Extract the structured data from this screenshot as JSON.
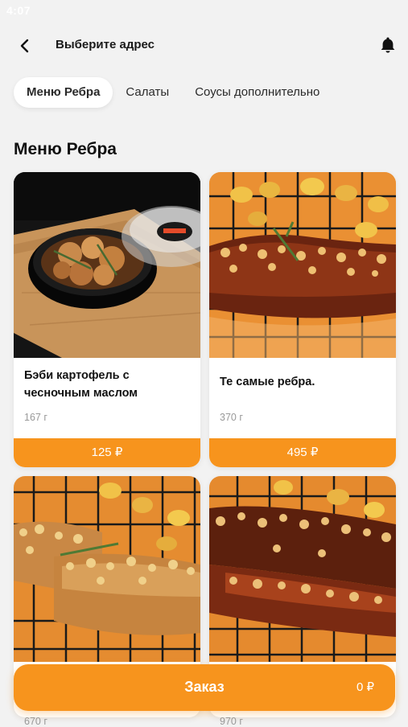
{
  "status": {
    "time": "4:07"
  },
  "header": {
    "title": "Выберите адрес",
    "back_icon": "chevron-left-icon",
    "bell_icon": "bell-icon"
  },
  "tabs": [
    {
      "label": "Меню Ребра",
      "active": true
    },
    {
      "label": "Салаты",
      "active": false
    },
    {
      "label": "Соусы дополнительно",
      "active": false
    }
  ],
  "section": {
    "title": "Меню Ребра"
  },
  "products": [
    {
      "name": "Бэби картофель с чесночным маслом",
      "weight": "167 г",
      "price": "125 ₽"
    },
    {
      "name": "Те самые ребра.",
      "weight": "370 г",
      "price": "495 ₽"
    },
    {
      "name": "",
      "weight": "670 г",
      "price": ""
    },
    {
      "name": "",
      "weight": "970 г",
      "price": ""
    }
  ],
  "order": {
    "label": "Заказ",
    "total": "0 ₽"
  },
  "colors": {
    "accent": "#f7941d",
    "background": "#f2f2f2",
    "card": "#ffffff"
  }
}
